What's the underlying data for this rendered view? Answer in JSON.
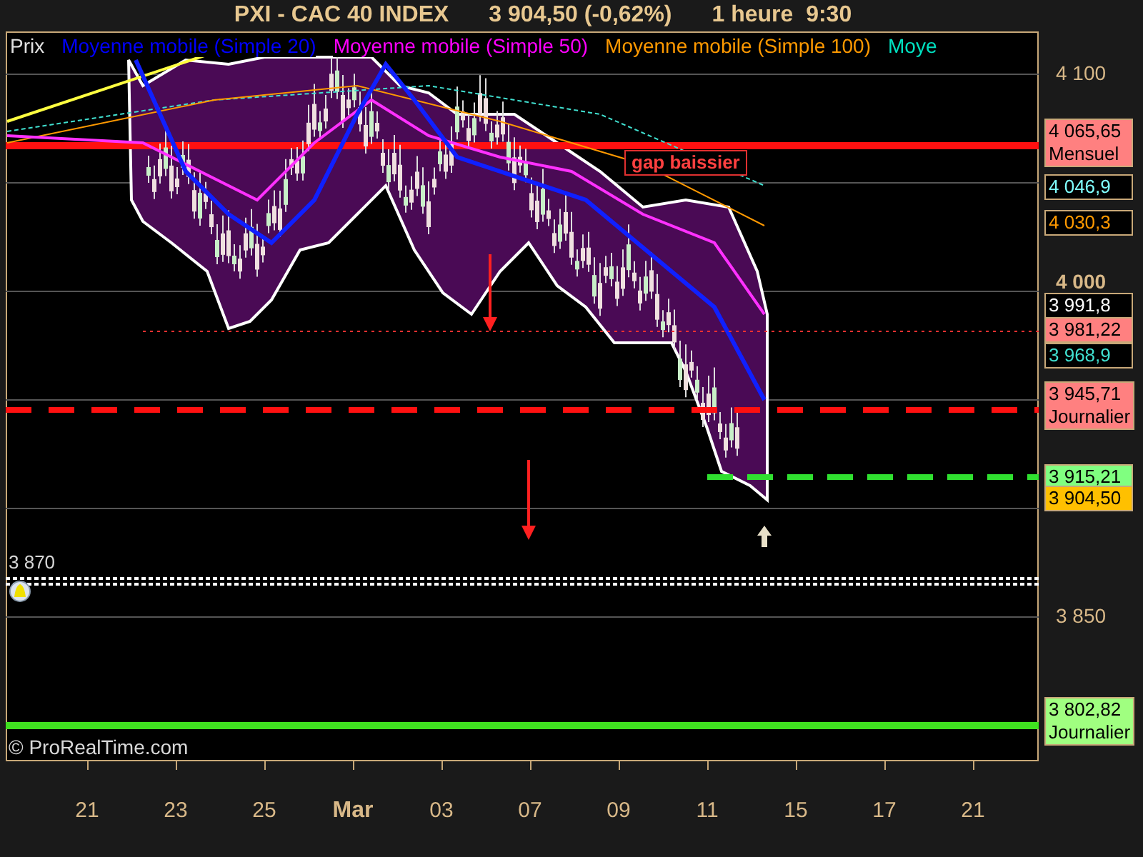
{
  "title": {
    "symbol": "PXI - CAC 40 INDEX",
    "price": "3 904,50 (-0,62%)",
    "timeframe": "1 heure",
    "time": "9:30"
  },
  "legend": [
    {
      "label": "Prix",
      "color": "#e0e0e0"
    },
    {
      "label": "Moyenne mobile (Simple 20)",
      "color": "#0000ff"
    },
    {
      "label": "Moyenne mobile (Simple 50)",
      "color": "#ff00ff"
    },
    {
      "label": "Moyenne mobile (Simple 100)",
      "color": "#ff9900"
    },
    {
      "label": "Moye",
      "color": "#00e0c0"
    }
  ],
  "annotation": "gap baissier",
  "alert": "3 870",
  "copyright": "© ProRealTime.com",
  "y_ticks": [
    {
      "label": "4 100",
      "kind": "normal"
    },
    {
      "label": "4 000",
      "kind": "bold"
    },
    {
      "label": "3 850",
      "kind": "normal"
    }
  ],
  "price_labels": [
    {
      "value": "4 065,65",
      "period": "Mensuel",
      "kind": "fill",
      "color": "#ff8080"
    },
    {
      "value": "4 046,9",
      "kind": "outline",
      "color": "#80ffff"
    },
    {
      "value": "4 030,3",
      "kind": "outline",
      "color": "#ff9900"
    },
    {
      "value": "3 991,8",
      "kind": "outline",
      "color": "#ffffff"
    },
    {
      "value": "3 981,22",
      "kind": "fill",
      "color": "#ff8080"
    },
    {
      "value": "3 968,9",
      "kind": "outline",
      "color": "#40e0d0"
    },
    {
      "value": "3 945,71",
      "period": "Journalier",
      "kind": "fill",
      "color": "#ff8080"
    },
    {
      "value": "3 915,21",
      "kind": "fill",
      "color": "#80ff80"
    },
    {
      "value": "3 904,50",
      "kind": "fill",
      "color": "#ffc000"
    },
    {
      "value": "3 802,82",
      "period": "Journalier",
      "kind": "fill",
      "color": "#a0ff80"
    }
  ],
  "x_ticks": [
    {
      "label": "21",
      "kind": "day"
    },
    {
      "label": "23",
      "kind": "day"
    },
    {
      "label": "25",
      "kind": "day"
    },
    {
      "label": "Mar",
      "kind": "month"
    },
    {
      "label": "03",
      "kind": "day"
    },
    {
      "label": "07",
      "kind": "day"
    },
    {
      "label": "09",
      "kind": "day"
    },
    {
      "label": "11",
      "kind": "day"
    },
    {
      "label": "15",
      "kind": "day"
    },
    {
      "label": "17",
      "kind": "day"
    },
    {
      "label": "21",
      "kind": "day"
    }
  ]
}
